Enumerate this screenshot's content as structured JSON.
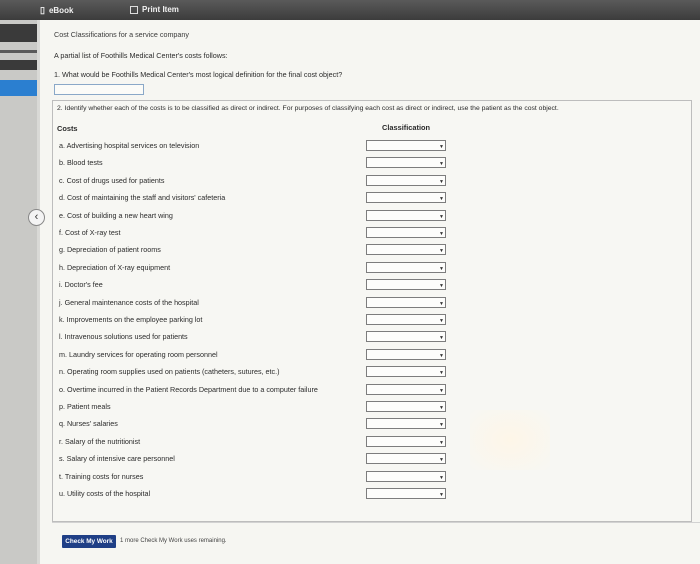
{
  "toolbar": {
    "ebook_label": "eBook",
    "print_label": "Print Item"
  },
  "page": {
    "heading": "Cost Classifications for a service company",
    "intro": "A partial list of Foothills Medical Center's costs follows:",
    "q1": "1.  What would be Foothills Medical Center's most logical definition for the final cost object?",
    "q2": "2.  Identify whether each of the costs is to be classified as direct or indirect. For purposes of classifying each cost as direct or indirect, use the patient as the cost object."
  },
  "table": {
    "col_costs": "Costs",
    "col_classification": "Classification",
    "rows": [
      {
        "label": "a.  Advertising hospital services on television"
      },
      {
        "label": "b.  Blood tests"
      },
      {
        "label": "c.  Cost of drugs used for patients"
      },
      {
        "label": "d.  Cost of maintaining the staff and visitors' cafeteria"
      },
      {
        "label": "e.  Cost of building a new heart wing"
      },
      {
        "label": "f.  Cost of X-ray test"
      },
      {
        "label": "g.  Depreciation of patient rooms"
      },
      {
        "label": "h.  Depreciation of X-ray equipment"
      },
      {
        "label": "i.  Doctor's fee"
      },
      {
        "label": "j.  General maintenance costs of the hospital"
      },
      {
        "label": "k.  Improvements on the employee parking lot"
      },
      {
        "label": "l.  Intravenous solutions used for patients"
      },
      {
        "label": "m.  Laundry services for operating room personnel"
      },
      {
        "label": "n.  Operating room supplies used on patients (catheters, sutures, etc.)"
      },
      {
        "label": "o.  Overtime incurred in the Patient Records Department due to a computer failure"
      },
      {
        "label": "p.  Patient meals"
      },
      {
        "label": "q.  Nurses' salaries"
      },
      {
        "label": "r.  Salary of the nutritionist"
      },
      {
        "label": "s.  Salary of intensive care personnel"
      },
      {
        "label": "t.  Training costs for nurses"
      },
      {
        "label": "u.  Utility costs of the hospital"
      }
    ]
  },
  "footer": {
    "check_label": "Check My Work",
    "remaining": "1 more Check My Work uses remaining."
  },
  "icons": {
    "ebook": "ebook-icon",
    "print": "print-icon",
    "back": "chevron-left-icon",
    "dropdown": "caret-down-icon"
  }
}
